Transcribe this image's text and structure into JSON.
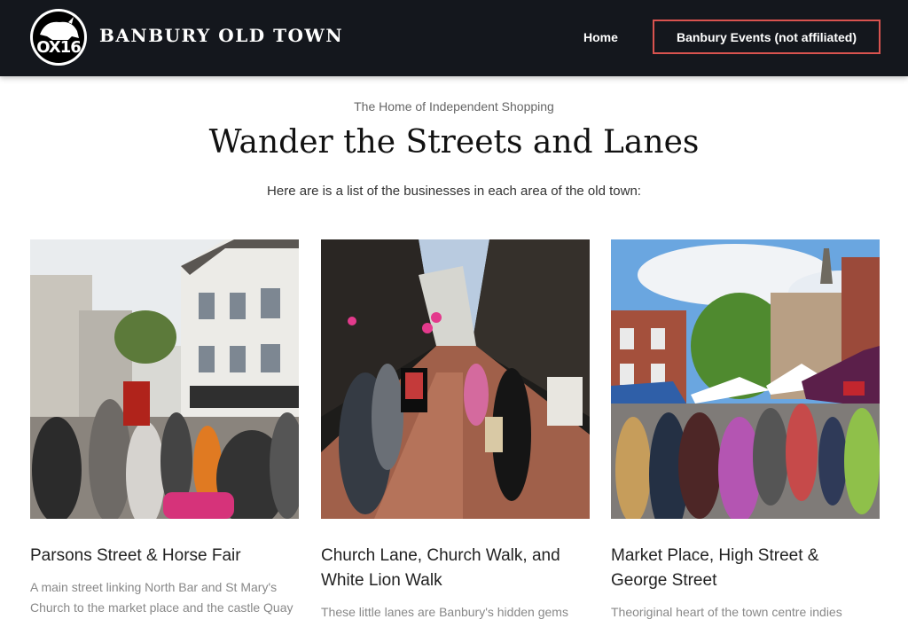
{
  "header": {
    "logo_text": "OX16",
    "site_title": "BANBURY OLD TOWN",
    "nav": {
      "home_label": "Home",
      "events_label": "Banbury Events (not affiliated)"
    }
  },
  "intro": {
    "tagline": "The Home of Independent Shopping",
    "headline": "Wander the Streets and Lanes",
    "text": "Here are is a list of the businesses in each area of the old town:"
  },
  "cards": [
    {
      "title": "Parsons Street & Horse Fair",
      "description": "A main street linking North Bar and St Mary's Church to the market place and the castle Quay"
    },
    {
      "title": "Church Lane, Church Walk, and White Lion Walk",
      "description": "These little lanes are Banbury's hidden gems that"
    },
    {
      "title": "Market Place, High Street & George Street",
      "description": "Theoriginal heart of the town centre indies"
    }
  ],
  "colors": {
    "header_bg": "#14171d",
    "accent_border": "#d9534f"
  }
}
